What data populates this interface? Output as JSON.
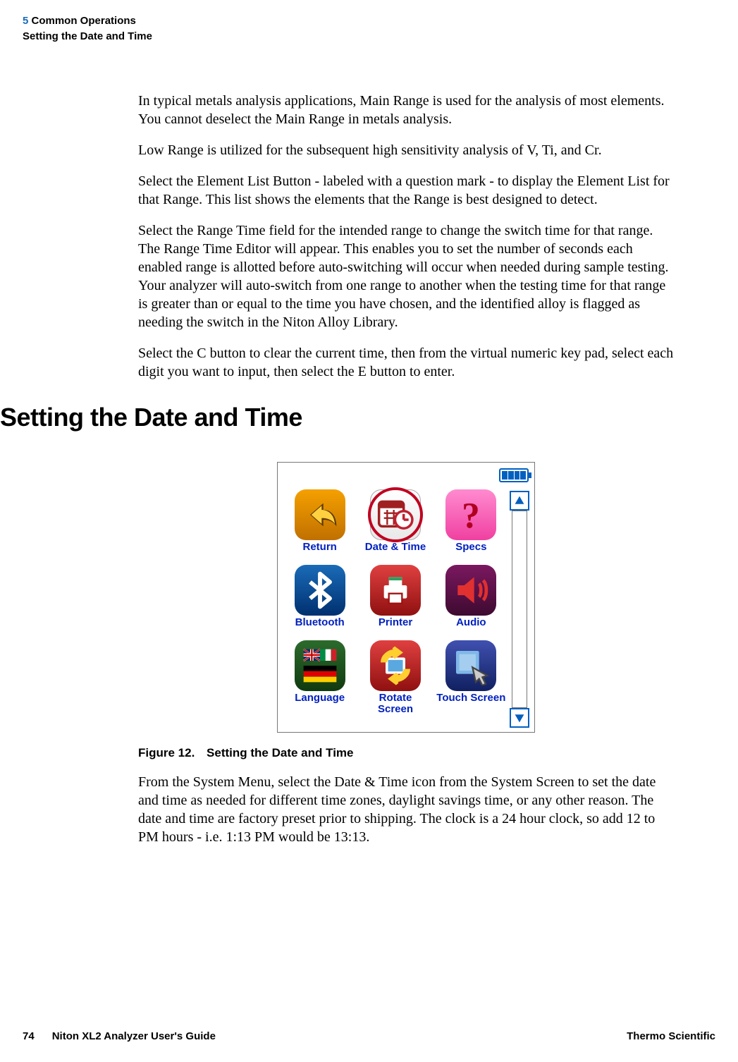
{
  "header": {
    "chapter_number": "5",
    "chapter_title": "Common Operations",
    "section": "Setting the Date and Time"
  },
  "body": {
    "p1": "In typical metals analysis applications, Main Range is used for the analysis of most elements. You cannot deselect the Main Range in metals analysis.",
    "p2": "Low Range is utilized for the subsequent high sensitivity analysis of V, Ti, and Cr.",
    "p3": "Select the Element List Button - labeled with a question mark - to display the Element List for that Range. This list shows the elements that the Range is best designed to detect.",
    "p4": "Select the Range Time field for the intended range to change the switch time for that range. The Range Time Editor will appear. This enables you to set the number of seconds each enabled range is allotted before auto-switching will occur when needed during sample testing. Your analyzer will auto-switch from one range to another when the testing time for that range is greater than or equal to the time you have chosen, and the identified alloy is flagged as needing the switch in the Niton Alloy Library.",
    "p5": "Select the C button to clear the current time, then from the virtual numeric key pad, select each digit you want to input, then select the E button to enter."
  },
  "heading": "Setting the Date and Time",
  "figure": {
    "label": "Figure 12.",
    "caption": "Setting the Date and Time",
    "menu": {
      "items": [
        {
          "label": "Return"
        },
        {
          "label": "Date & Time"
        },
        {
          "label": "Specs"
        },
        {
          "label": "Bluetooth"
        },
        {
          "label": "Printer"
        },
        {
          "label": "Audio"
        },
        {
          "label": "Language"
        },
        {
          "label": "Rotate Screen"
        },
        {
          "label": "Touch Screen"
        }
      ]
    }
  },
  "after_figure": {
    "p1": "From the System Menu, select the Date & Time icon from the System Screen to set the date and time as needed for different time zones, daylight savings time, or any other reason. The date and time are factory preset prior to shipping. The clock is a 24 hour clock, so add 12 to PM hours - i.e. 1:13 PM would be 13:13."
  },
  "footer": {
    "page_number": "74",
    "guide_title": "Niton XL2 Analyzer User's Guide",
    "company": "Thermo Scientific"
  }
}
